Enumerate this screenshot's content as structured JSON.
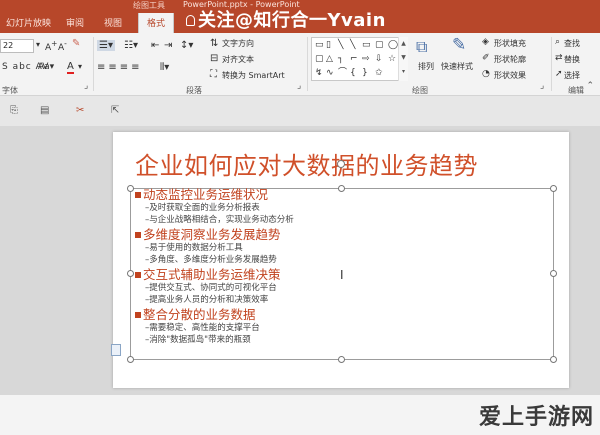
{
  "titlebar": {
    "context_label": "绘图工具",
    "file_title": "PowerPoint.pptx - PowerPoint",
    "watermark": "关注@知行合一Yvain"
  },
  "tabs": [
    "幻灯片放映",
    "审阅",
    "视图",
    "格式"
  ],
  "ribbon": {
    "font_size": "22",
    "groups": {
      "font_label": "字体",
      "paragraph_label": "段落",
      "drawing_label": "绘图",
      "editing_label": "编辑"
    },
    "text_direction": "文字方向",
    "align_text": "对齐文本",
    "convert_smartart": "转换为 SmartArt",
    "arrange": "排列",
    "quick_styles": "快速样式",
    "shape_fill": "形状填充",
    "shape_outline": "形状轮廓",
    "shape_effects": "形状效果",
    "find": "查找",
    "replace": "替换",
    "select": "选择"
  },
  "colors": {
    "accent": "#b7472a",
    "title_text": "#d0502a",
    "heading_text": "#c1431f"
  },
  "slide": {
    "title": "企业如何应对大数据的业务趋势",
    "sections": [
      {
        "heading": "动态监控业务运维状况",
        "items": [
          "–及时获取全面的业务分析报表",
          "–与企业战略相结合，实现业务动态分析"
        ]
      },
      {
        "heading": "多维度洞察业务发展趋势",
        "items": [
          "–易于使用的数据分析工具",
          "–多角度、多维度分析业务发展趋势"
        ]
      },
      {
        "heading": "交互式辅助业务运维决策",
        "items": [
          "–提供交互式、协同式的可视化平台",
          "–提高业务人员的分析和决策效率"
        ]
      },
      {
        "heading": "整合分散的业务数据",
        "items": [
          "–需要稳定、高性能的支撑平台",
          "–消除\"数据孤岛\"带来的瓶颈"
        ]
      }
    ]
  },
  "bottom_watermark": "爱上手游网"
}
